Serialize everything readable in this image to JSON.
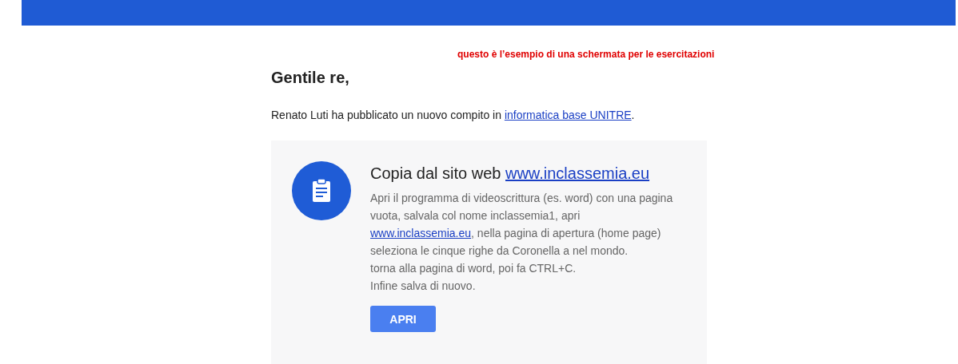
{
  "note": "questo è l’esempio di una schermata per le esercitazioni",
  "greeting": "Gentile re,",
  "intro": {
    "before": "Renato Luti ha pubblicato un nuovo compito in ",
    "link": "informatica base UNITRE",
    "after": "."
  },
  "card": {
    "title": "Copia dal sito web ",
    "title_link": "www.inclassemia.eu",
    "body": {
      "before": "Apri il programma di videoscrittura (es. word) con una pagina\nvuota, salvala col nome inclassemia1, apri\n",
      "link": "www.inclassemia.eu",
      "after": ", nella pagina di apertura (home page)\nseleziona le cinque righe da Coronella a nel mondo.\ntorna alla pagina di word, poi fa CTRL+C.\nInfine salva di nuovo."
    },
    "button": "APRI"
  }
}
